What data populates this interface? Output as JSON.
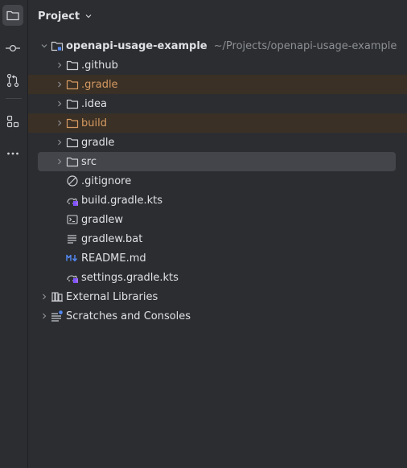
{
  "activity_bar": {
    "items": [
      {
        "icon": "folder-icon",
        "active": true
      },
      {
        "icon": "commit-icon",
        "active": false
      },
      {
        "icon": "pull-request-icon",
        "active": false
      },
      {
        "icon": "structure-icon",
        "active": false
      },
      {
        "icon": "more-icon",
        "active": false
      }
    ]
  },
  "panel": {
    "title": "Project",
    "title_icon": "chevron-down-icon"
  },
  "tree": {
    "root": {
      "name": "openapi-usage-example",
      "path": "~/Projects/openapi-usage-example",
      "expanded": true
    },
    "children": [
      {
        "name": ".github",
        "type": "folder",
        "collapsed": true
      },
      {
        "name": ".gradle",
        "type": "folder",
        "collapsed": true,
        "ignored": true
      },
      {
        "name": ".idea",
        "type": "folder",
        "collapsed": true
      },
      {
        "name": "build",
        "type": "folder",
        "collapsed": true,
        "ignored": true
      },
      {
        "name": "gradle",
        "type": "folder",
        "collapsed": true
      },
      {
        "name": "src",
        "type": "folder",
        "collapsed": true,
        "selected": true
      },
      {
        "name": ".gitignore",
        "type": "gitignore-file"
      },
      {
        "name": "build.gradle.kts",
        "type": "gradle-kotlin-file"
      },
      {
        "name": "gradlew",
        "type": "terminal-file"
      },
      {
        "name": "gradlew.bat",
        "type": "text-file"
      },
      {
        "name": "README.md",
        "type": "markdown-file"
      },
      {
        "name": "settings.gradle.kts",
        "type": "gradle-kotlin-file"
      }
    ],
    "external_libraries": "External Libraries",
    "scratches": "Scratches and Consoles"
  },
  "colors": {
    "background": "#2b2d30",
    "selection": "#43454a",
    "ignored_bg": "#3a3025",
    "ignored_text": "#d59a62",
    "text": "#dfe1e5",
    "muted": "#8c8f94",
    "accent_blue": "#548af7"
  }
}
